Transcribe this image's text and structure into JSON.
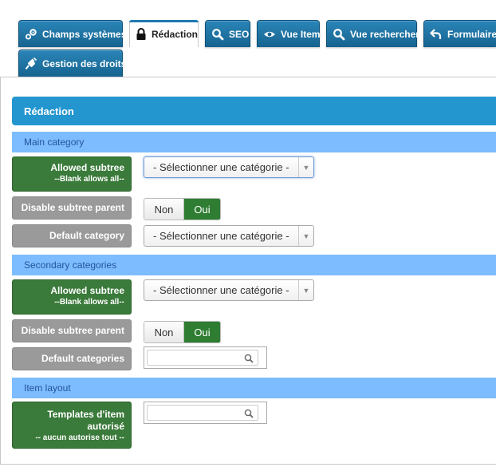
{
  "tabs": [
    {
      "label": "Champs systèmes",
      "icon": "cogs-icon"
    },
    {
      "label": "Rédaction",
      "icon": "lock-icon"
    },
    {
      "label": "SEO",
      "icon": "search-icon"
    },
    {
      "label": "Vue Item",
      "icon": "eye-icon"
    },
    {
      "label": "Vue rechercher",
      "icon": "search-icon"
    },
    {
      "label": "Formulaire c",
      "icon": "back-arrow-icon"
    },
    {
      "label": "Gestion des droits",
      "icon": "plug-icon"
    }
  ],
  "active_tab": "Rédaction",
  "section": {
    "title": "Rédaction"
  },
  "groups": {
    "main": {
      "title": "Main category",
      "allowed_subtree": {
        "label": "Allowed subtree",
        "hint": "--Blank allows all--",
        "value": "- Sélectionner une catégorie -"
      },
      "disable_parent": {
        "label": "Disable subtree parent",
        "no": "Non",
        "yes": "Oui",
        "selected": "Oui"
      },
      "default_category": {
        "label": "Default category",
        "value": "- Sélectionner une catégorie -"
      }
    },
    "secondary": {
      "title": "Secondary categories",
      "allowed_subtree": {
        "label": "Allowed subtree",
        "hint": "--Blank allows all--",
        "value": "- Sélectionner une catégorie -"
      },
      "disable_parent": {
        "label": "Disable subtree parent",
        "no": "Non",
        "yes": "Oui",
        "selected": "Oui"
      },
      "default_categories": {
        "label": "Default categories",
        "value": ""
      }
    },
    "layout": {
      "title": "Item layout",
      "templates": {
        "label": "Templates d'item autorisé",
        "hint": "-- aucun autorise tout --",
        "value": ""
      }
    }
  },
  "colors": {
    "tab": "#1e74a6",
    "section_bar": "#2396cf",
    "group_bar": "#7dbcff",
    "label_green": "#3a7a3a",
    "label_grey": "#9a9a9a",
    "toggle_yes": "#2e7d32"
  }
}
